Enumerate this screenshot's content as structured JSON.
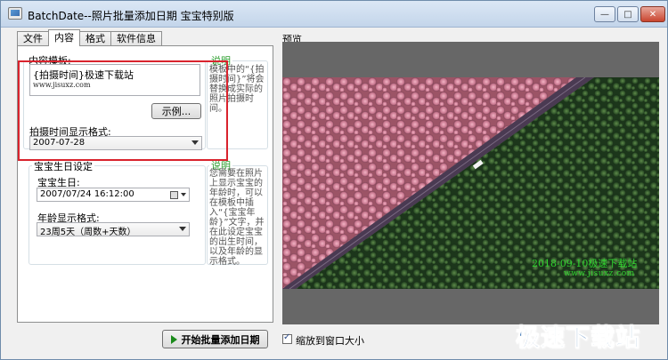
{
  "window": {
    "title": "BatchDate--照片批量添加日期 宝宝特别版"
  },
  "tabs": [
    {
      "label": "文件"
    },
    {
      "label": "内容"
    },
    {
      "label": "格式"
    },
    {
      "label": "软件信息"
    }
  ],
  "content_template": {
    "label": "内容模板:",
    "line1": "{拍摄时间}极速下载站",
    "line2": "www.jisuxz.com",
    "example_button": "示例...",
    "note_label": "说明",
    "note_text": "模板中的“{拍摄时间}”将会替换成实际的照片拍摄时间。"
  },
  "shoot_time_format": {
    "label": "拍摄时间显示格式:",
    "value": "2007-07-28"
  },
  "baby_birthday": {
    "group_label": "宝宝生日设定",
    "birthday_label": "宝宝生日:",
    "birthday_value": "2007/07/24  16:12:00",
    "age_format_label": "年龄显示格式:",
    "age_format_value": "23周5天（周数+天数）",
    "note_label": "说明",
    "note_text": "您需要在照片上显示宝宝的年龄时，可以在模板中插入“{宝宝年龄}”文字，并在此设定宝宝的出生时间，以及年龄的显示格式。"
  },
  "preview": {
    "label": "预览",
    "watermark_line1": "2018-09-10极速下载站",
    "watermark_line2": "www.jisuxz.com"
  },
  "footer": {
    "run_button": "开始批量添加日期",
    "fit_checkbox_label": "缩放到窗口大小",
    "fit_checked": true
  },
  "site_logo": "极速下载站",
  "colors": {
    "highlight": "#d9232d",
    "note_green": "#2f9e2f",
    "watermark_green": "#2fd22f",
    "logo_blue": "#1f5fa8"
  }
}
